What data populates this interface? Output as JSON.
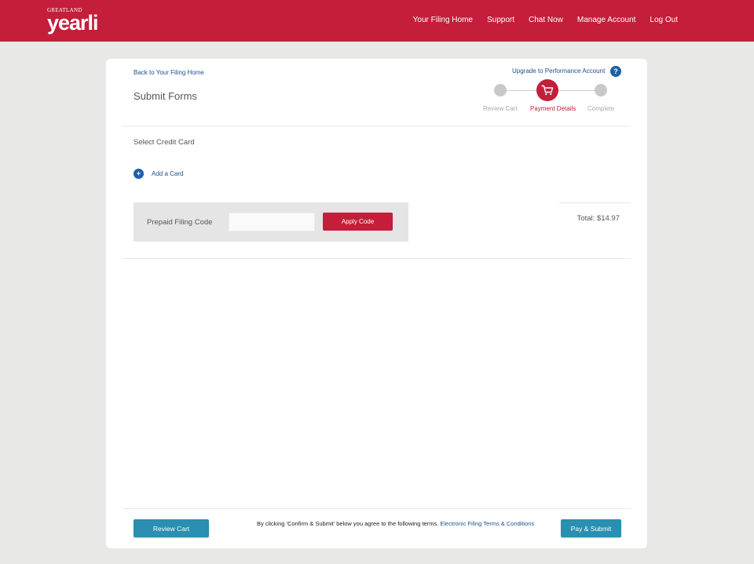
{
  "header": {
    "logo_small": "GREATLAND",
    "logo_big": "yearli",
    "nav": [
      "Your Filing Home",
      "Support",
      "Chat Now",
      "Manage Account",
      "Log Out"
    ]
  },
  "page": {
    "back_link": "Back to Your Filing Home",
    "title": "Submit Forms",
    "upgrade_link": "Upgrade to Performance Account",
    "help_icon": "?"
  },
  "stepper": {
    "steps": [
      "Review Cart",
      "Payment Details",
      "Complete"
    ],
    "active_step": "Payment Details"
  },
  "payment": {
    "section_title": "Select Credit Card",
    "add_card_icon": "+",
    "add_card_label": "Add a Card",
    "prepaid_label": "Prepaid Filing Code",
    "prepaid_value": "",
    "prepaid_placeholder": "",
    "apply_button": "Apply Code",
    "total": "Total: $14.97"
  },
  "footer": {
    "review_button": "Review Cart",
    "terms_text": "By clicking 'Confirm & Submit' below you agree to the following terms.",
    "terms_link": "Electronic Filing Terms & Conditions",
    "pay_button": "Pay & Submit"
  },
  "colors": {
    "brand_red": "#c41e3a",
    "link_blue": "#1f4e8c",
    "button_teal": "#2a8fb0",
    "background": "#e8e8e6"
  },
  "icons": {
    "help": "question-circle-icon",
    "add": "plus-circle-icon",
    "cart": "shopping-cart-icon"
  }
}
